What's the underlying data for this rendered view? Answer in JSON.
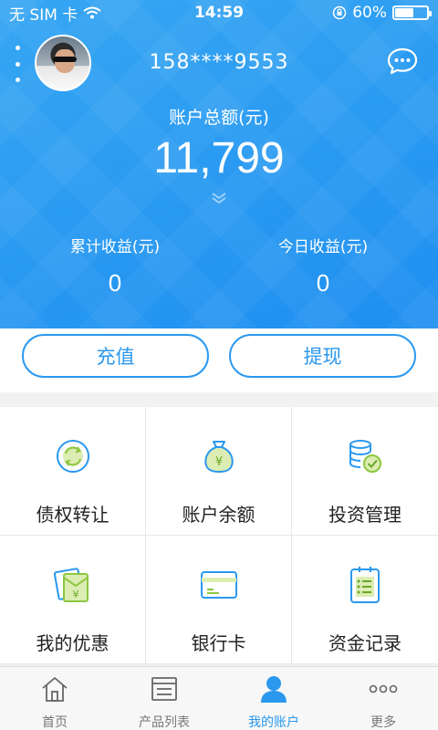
{
  "status_bar": {
    "carrier": "无 SIM 卡",
    "time": "14:59",
    "battery": "60%",
    "battery_level": 0.6
  },
  "header": {
    "phone": "158****9553",
    "menu_icon": "menu-dots-icon",
    "message_icon": "chat-icon"
  },
  "account": {
    "total_label": "账户总额(元)",
    "total_value": "11,799",
    "cumulative_label": "累计收益(元)",
    "cumulative_value": "0",
    "today_label": "今日收益(元)",
    "today_value": "0"
  },
  "actions": {
    "recharge": "充值",
    "withdraw": "提现"
  },
  "grid": [
    {
      "label": "债权转让",
      "icon": "transfer-icon"
    },
    {
      "label": "账户余额",
      "icon": "money-bag-icon"
    },
    {
      "label": "投资管理",
      "icon": "coins-check-icon"
    },
    {
      "label": "我的优惠",
      "icon": "coupon-icon"
    },
    {
      "label": "银行卡",
      "icon": "bank-card-icon"
    },
    {
      "label": "资金记录",
      "icon": "clipboard-list-icon"
    }
  ],
  "tabbar": [
    {
      "label": "首页",
      "icon": "home-icon",
      "active": false
    },
    {
      "label": "产品列表",
      "icon": "product-list-icon",
      "active": false
    },
    {
      "label": "我的账户",
      "icon": "user-icon",
      "active": true
    },
    {
      "label": "更多",
      "icon": "more-icon",
      "active": false
    }
  ],
  "colors": {
    "primary": "#2a98ef",
    "hero_top": "#36a6f3",
    "icon_green": "#8dc63f"
  }
}
